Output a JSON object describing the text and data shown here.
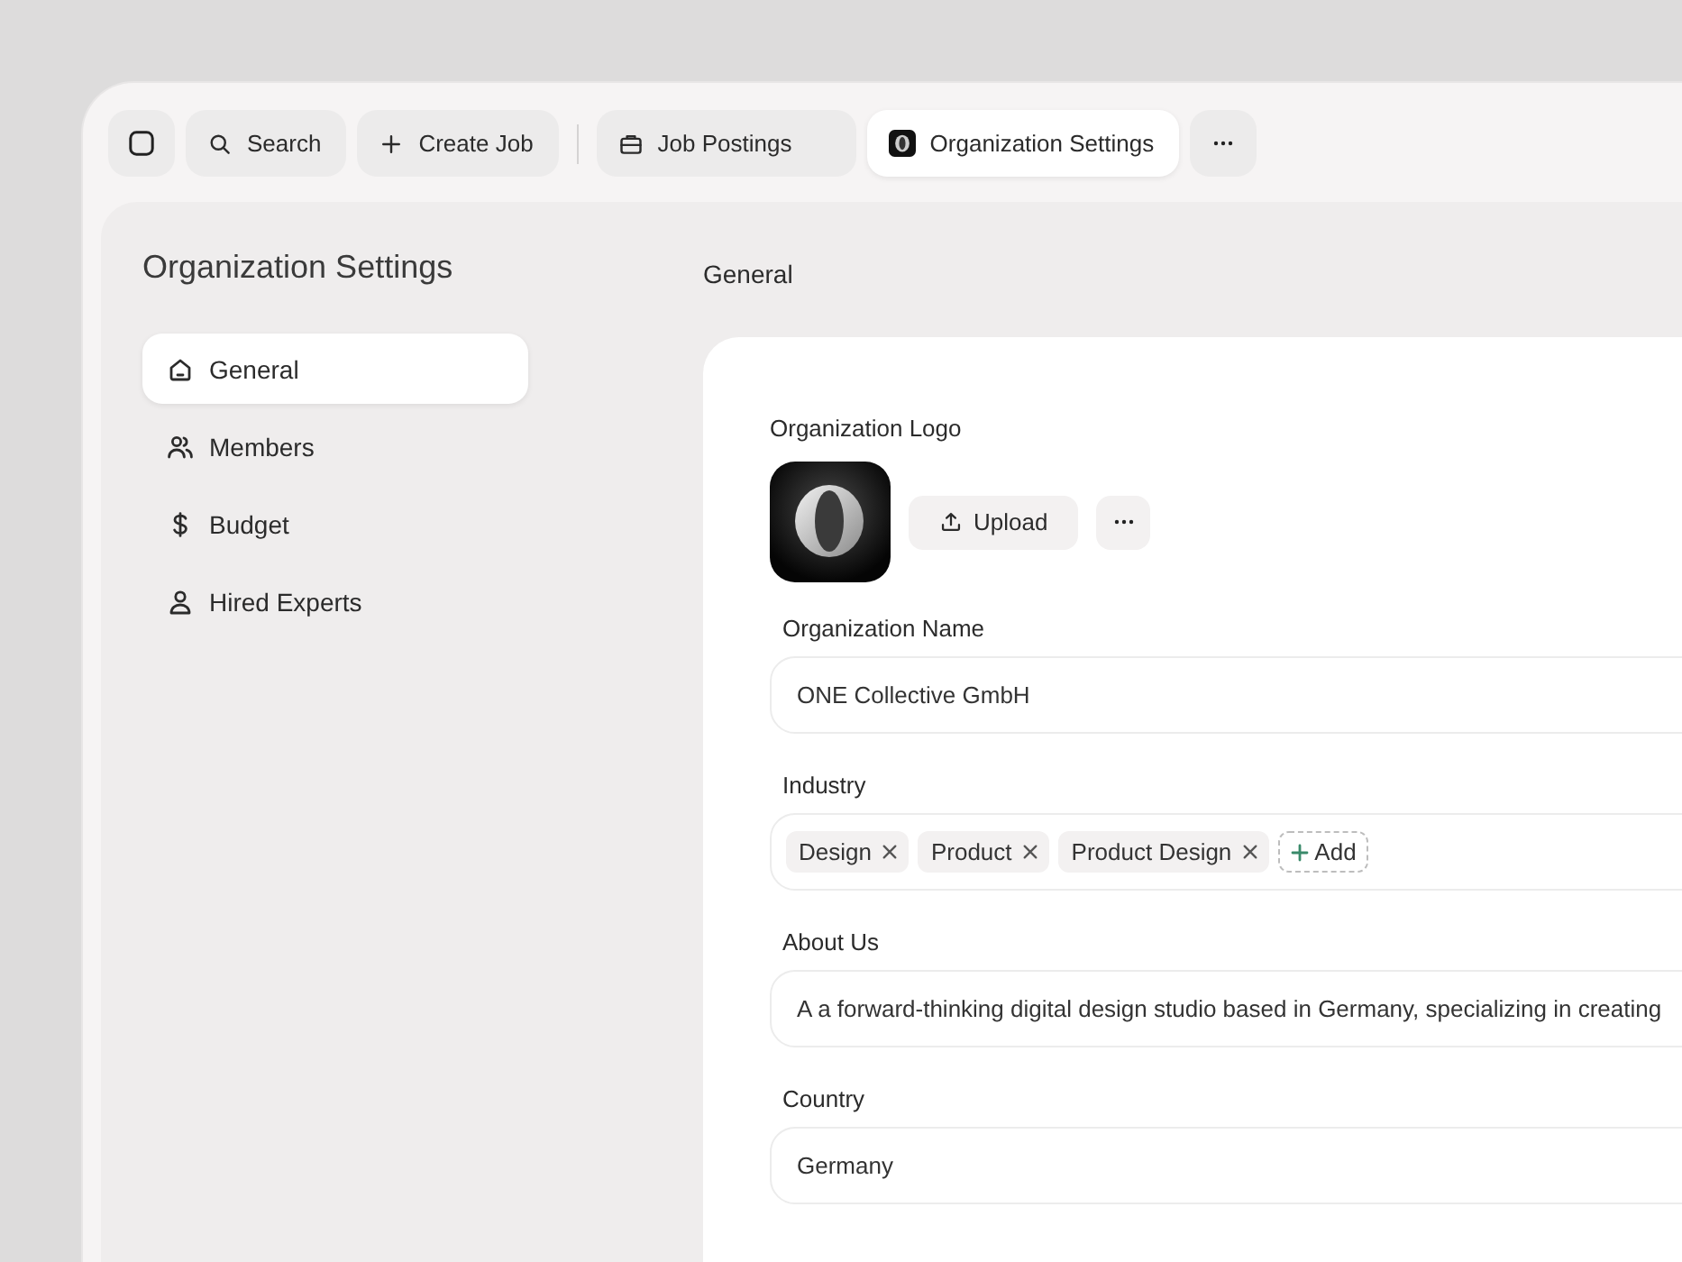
{
  "toolbar": {
    "actions": [
      {
        "kind": "search",
        "label": "Search"
      },
      {
        "kind": "create",
        "label": "Create Job"
      }
    ],
    "tabs": [
      {
        "kind": "briefcase",
        "label": "Job Postings",
        "selected": false
      },
      {
        "kind": "logo",
        "label": "Organization Settings",
        "selected": true
      }
    ]
  },
  "sidebar": {
    "title": "Organization Settings",
    "items": [
      {
        "kind": "home",
        "label": "General",
        "selected": true
      },
      {
        "kind": "people",
        "label": "Members",
        "selected": false
      },
      {
        "kind": "dollar",
        "label": "Budget",
        "selected": false
      },
      {
        "kind": "person",
        "label": "Hired Experts",
        "selected": false
      }
    ]
  },
  "main": {
    "title": "General",
    "logo": {
      "label": "Organization Logo",
      "upload": "Upload"
    },
    "fields": [
      {
        "kind": "text",
        "label": "Organization Name",
        "value": "ONE Collective GmbH"
      },
      {
        "kind": "tags",
        "label": "Industry",
        "tags": [
          "Design",
          "Product",
          "Product Design"
        ],
        "add": "Add"
      },
      {
        "kind": "text",
        "label": "About Us",
        "value": "A a forward-thinking digital design studio based in Germany, specializing in creating"
      },
      {
        "kind": "text",
        "label": "Country",
        "value": "Germany"
      }
    ]
  }
}
